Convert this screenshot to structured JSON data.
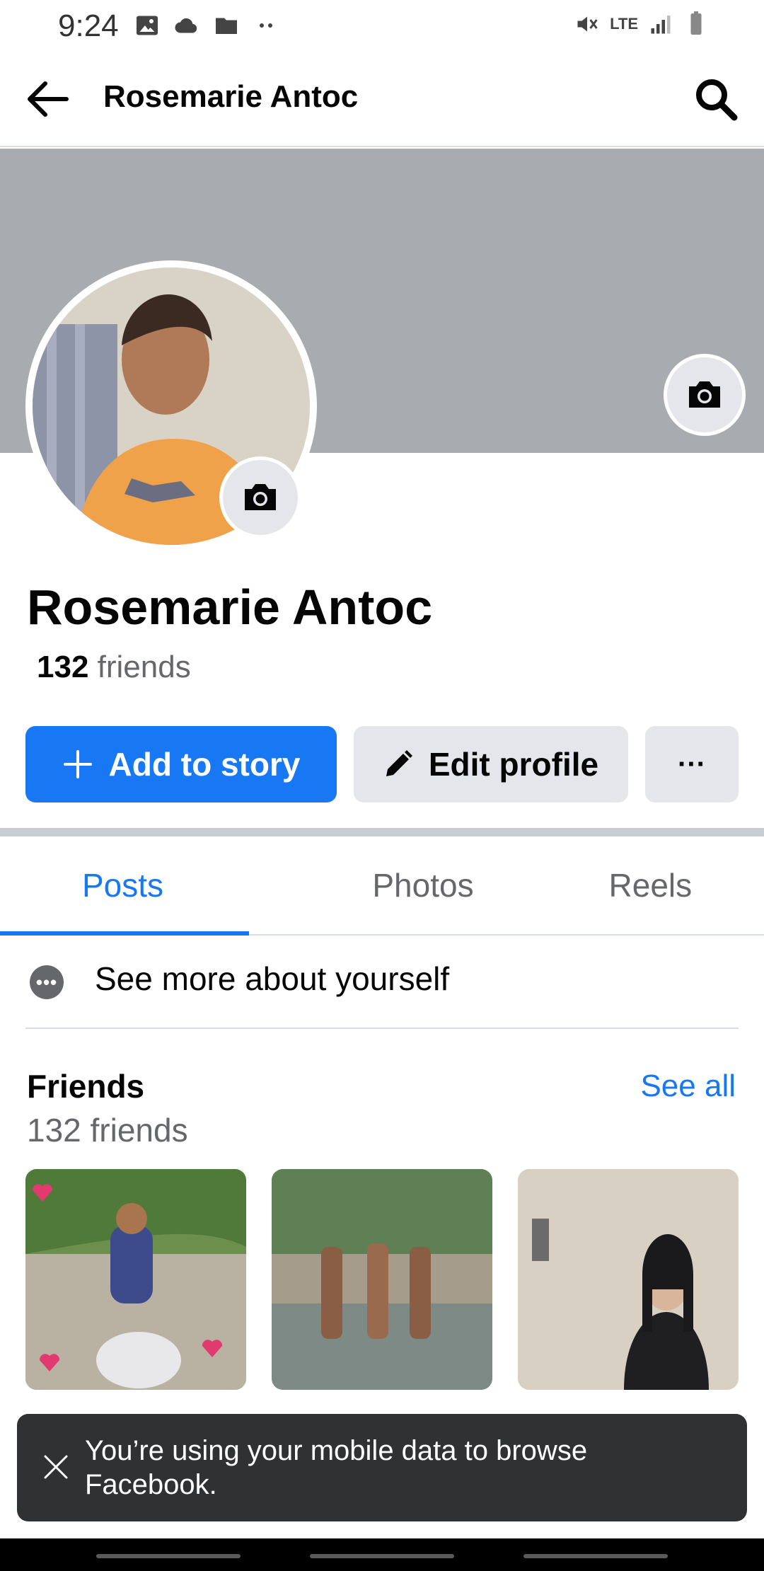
{
  "status_bar": {
    "time": "9:24",
    "left_icons": [
      "image-icon",
      "cloud-icon",
      "folder-icon",
      "more-dots-icon"
    ],
    "right_icons": [
      "mute-icon",
      "lte-icon",
      "signal-icon",
      "battery-icon"
    ],
    "network": "LTE"
  },
  "header": {
    "title": "Rosemarie Antoc",
    "back_icon": "arrow-left-icon",
    "search_icon": "search-icon"
  },
  "profile": {
    "name": "Rosemarie Antoc",
    "friends_count": "132",
    "friends_suffix": " friends"
  },
  "actions": {
    "add_to_story": "Add to story",
    "edit_profile": "Edit profile",
    "more": "···"
  },
  "tabs": [
    {
      "label": "Posts",
      "active": true
    },
    {
      "label": "Photos",
      "active": false
    },
    {
      "label": "Reels",
      "active": false
    }
  ],
  "about": {
    "label": "See more about yourself"
  },
  "friends_section": {
    "title": "Friends",
    "see_all": "See all",
    "count_text": "132 friends",
    "thumbnails": [
      "friend-photo-motorbike",
      "friend-photo-beach",
      "friend-photo-portrait"
    ]
  },
  "toast": {
    "message": "You’re using your mobile data to browse Facebook."
  },
  "colors": {
    "accent": "#1877f2",
    "button_gray": "#e4e6eb",
    "cover": "#a8abaf",
    "toast_bg": "#2f3133"
  }
}
